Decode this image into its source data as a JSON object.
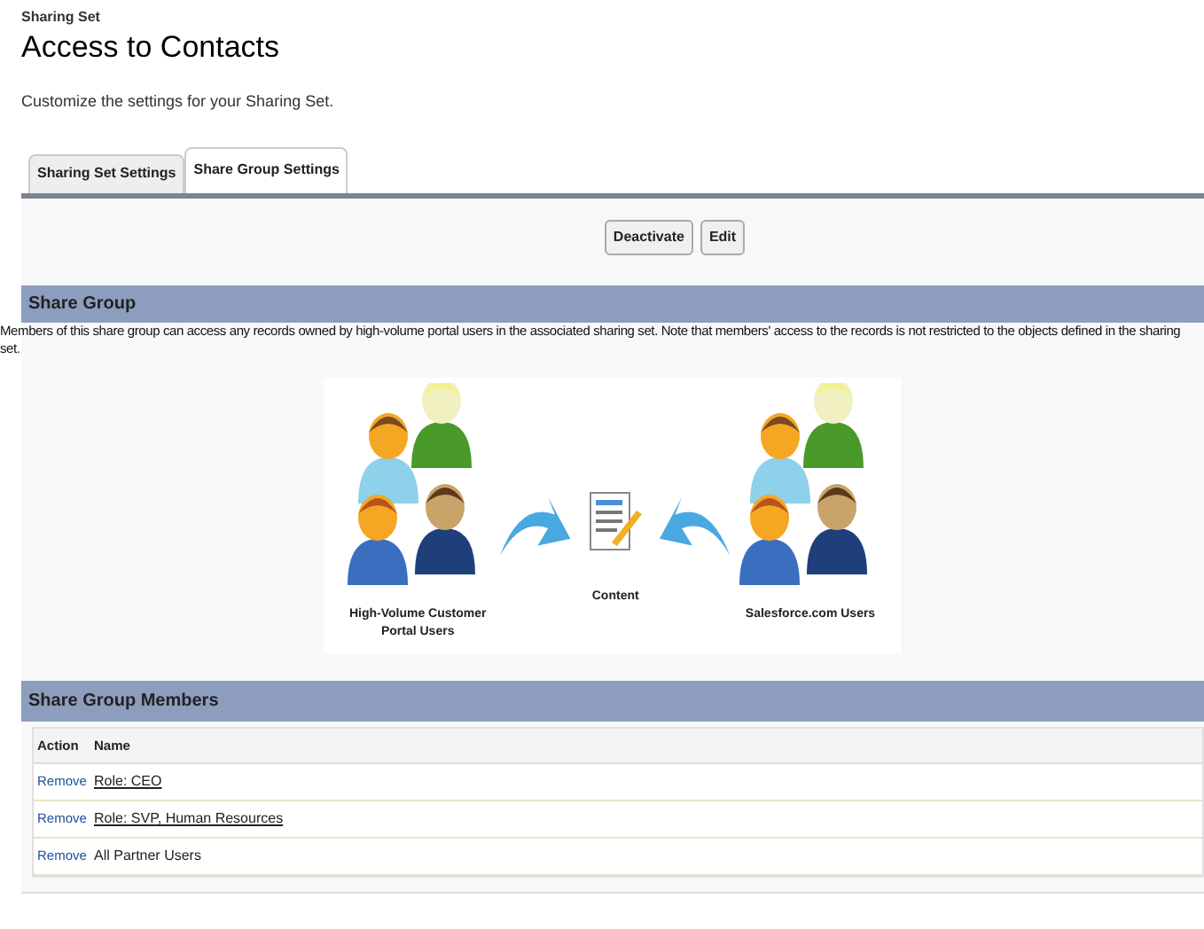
{
  "page_header": {
    "object_type": "Sharing Set",
    "title": "Access to Contacts",
    "description": "Customize the settings for your Sharing Set."
  },
  "tabs": [
    {
      "label": "Sharing Set Settings",
      "selected": false
    },
    {
      "label": "Share Group Settings",
      "selected": true
    }
  ],
  "buttons": [
    "Deactivate",
    "Edit"
  ],
  "share_group": {
    "heading": "Share Group",
    "description": "Members of this share group can access any records owned by high-volume portal users in the associated sharing set. Note that members' access to the records is not restricted to the objects defined in the sharing set.",
    "diagram": {
      "left_label": "High-Volume Customer Portal Users",
      "center_label": "Content",
      "right_label": "Salesforce.com Users"
    }
  },
  "members": {
    "heading": "Share Group Members",
    "columns": [
      "Action",
      "Name"
    ],
    "rows": [
      {
        "action": "Remove",
        "name": "Role: CEO",
        "kind": "link"
      },
      {
        "action": "Remove",
        "name": "Role: SVP, Human Resources",
        "kind": "link"
      },
      {
        "action": "Remove",
        "name": "All Partner Users",
        "kind": "text"
      }
    ]
  }
}
